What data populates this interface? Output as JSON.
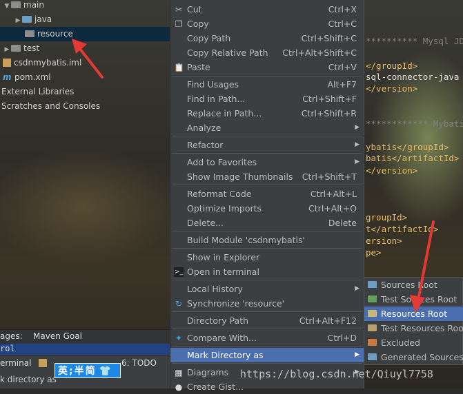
{
  "tree": {
    "main": "main",
    "java": "java",
    "resource": "resource",
    "test": "test",
    "iml": "csdnmybatis.iml",
    "pom": "pom.xml",
    "ext_libs": "External Libraries",
    "scratches": "Scratches and Consoles"
  },
  "code": {
    "l1": "********** Mysql JD",
    "l2": "</groupId>",
    "l3": "sql-connector-java",
    "l4": "</version>",
    "l5": "************ Mybati",
    "l6": "ybatis</groupId>",
    "l7": "batis</artifactId>",
    "l8": "</version>",
    "l9": "groupId>",
    "l10": "t</artifactId>",
    "l11": "ersion>",
    "l12": "pe>"
  },
  "bottom": {
    "messages_tab": "ages:",
    "maven_goal": "Maven Goal",
    "terminal": "erminal",
    "todo": "6: TODO",
    "status": "k directory as",
    "ime": "英;半简",
    "code_row": "rol"
  },
  "menu": {
    "cut": {
      "label": "Cut",
      "shortcut": "Ctrl+X",
      "icon": "scissors-icon"
    },
    "copy": {
      "label": "Copy",
      "shortcut": "Ctrl+C",
      "icon": "copy-icon"
    },
    "copy_path": {
      "label": "Copy Path",
      "shortcut": "Ctrl+Shift+C"
    },
    "copy_relative_path": {
      "label": "Copy Relative Path",
      "shortcut": "Ctrl+Alt+Shift+C"
    },
    "paste": {
      "label": "Paste",
      "shortcut": "Ctrl+V",
      "icon": "clipboard-icon"
    },
    "find_usages": {
      "label": "Find Usages",
      "shortcut": "Alt+F7"
    },
    "find_in_path": {
      "label": "Find in Path...",
      "shortcut": "Ctrl+Shift+F"
    },
    "replace_in_path": {
      "label": "Replace in Path...",
      "shortcut": "Ctrl+Shift+R"
    },
    "analyze": {
      "label": "Analyze"
    },
    "refactor": {
      "label": "Refactor"
    },
    "add_to_favorites": {
      "label": "Add to Favorites"
    },
    "show_thumbnails": {
      "label": "Show Image Thumbnails",
      "shortcut": "Ctrl+Shift+T"
    },
    "reformat_code": {
      "label": "Reformat Code",
      "shortcut": "Ctrl+Alt+L"
    },
    "optimize_imports": {
      "label": "Optimize Imports",
      "shortcut": "Ctrl+Alt+O"
    },
    "delete": {
      "label": "Delete...",
      "shortcut": "Delete"
    },
    "build_module": {
      "label": "Build Module 'csdnmybatis'"
    },
    "show_in_explorer": {
      "label": "Show in Explorer"
    },
    "open_in_terminal": {
      "label": "Open in terminal",
      "icon": "terminal-icon"
    },
    "local_history": {
      "label": "Local History"
    },
    "synchronize": {
      "label": "Synchronize 'resource'",
      "icon": "sync-icon"
    },
    "directory_path": {
      "label": "Directory Path",
      "shortcut": "Ctrl+Alt+F12"
    },
    "compare_with": {
      "label": "Compare With...",
      "shortcut": "Ctrl+D",
      "icon": "compare-icon"
    },
    "mark_directory_as": {
      "label": "Mark Directory as"
    },
    "diagrams": {
      "label": "Diagrams",
      "icon": "diagram-icon"
    },
    "create_gist": {
      "label": "Create Gist..."
    }
  },
  "submenu": {
    "sources_root": "Sources Root",
    "test_sources_root": "Test Sources Root",
    "resources_root": "Resources Root",
    "test_resources_root": "Test Resources Root",
    "excluded": "Excluded",
    "generated_sources_root": "Generated Sources R"
  },
  "watermark": "https://blog.csdn.net/Qiuyl7758",
  "colors": {
    "menu_bg": "#3c3f41",
    "highlight": "#4b6eaf",
    "selected_tree": "#0d293e",
    "annotation_arrow": "#e53935"
  }
}
